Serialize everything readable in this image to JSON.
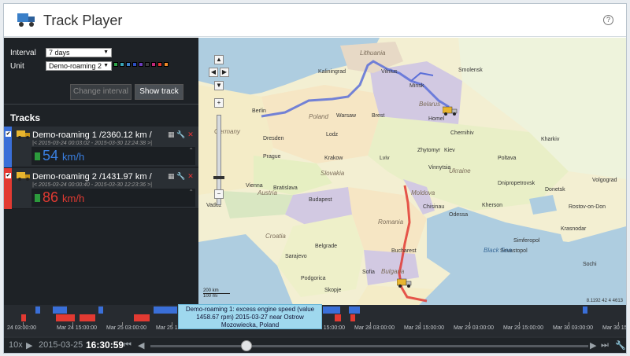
{
  "app": {
    "title": "Track Player",
    "help": "?"
  },
  "controls": {
    "interval_label": "Interval",
    "interval_value": "7 days",
    "unit_label": "Unit",
    "unit_value": "Demo-roaming 2",
    "swatch_colors": [
      "#2ea84a",
      "#3aa6b9",
      "#3d7fc7",
      "#2c4fc2",
      "#6d3dbd",
      "#3c3c3c",
      "#c2287b",
      "#e23a32",
      "#f28c28"
    ],
    "change_interval_label": "Change interval",
    "show_track_label": "Show track"
  },
  "tracks_title": "Tracks",
  "tracks": [
    {
      "name": "Demo-roaming 1 /2360.12 km /",
      "dates": "2015-03-24 00:03:02 - 2015-03-30 12:24:38",
      "speed": "54",
      "speed_unit": "km/h",
      "color": "#3a6fd8"
    },
    {
      "name": "Demo-roaming 2 /1431.97 km /",
      "dates": "2015-03-24 00:00:40 - 2015-03-30 12:23:36",
      "speed": "86",
      "speed_unit": "km/h",
      "color": "#e23a32"
    }
  ],
  "map": {
    "countries": [
      "Lithuania",
      "Belarus",
      "Poland",
      "Germany",
      "Ukraine",
      "Slovakia",
      "Austria",
      "Moldova",
      "Romania",
      "Croatia",
      "Bulgaria"
    ],
    "cities": [
      "Smolensk",
      "Vilnius",
      "Minsk",
      "Kaliningrad",
      "Berlin",
      "Warsaw",
      "Brest",
      "Homel",
      "Chernihiv",
      "Dresden",
      "Lodz",
      "Kiev",
      "Prague",
      "Zhytomyr",
      "Kharkiv",
      "Krakow",
      "Lviv",
      "Poltava",
      "Vinnytsia",
      "Bratislava",
      "Vienna",
      "Budapest",
      "Dnipropetrovsk",
      "Chisinau",
      "Odessa",
      "Belgrade",
      "Sarajevo",
      "Bucharest",
      "Sofia",
      "Simferopol",
      "Sevastopol",
      "Podgorica",
      "Skopje",
      "Vaduz",
      "Kherson",
      "Volgograd",
      "Donetsk",
      "Rostov-on-Don",
      "Krasnodar",
      "Sochi"
    ],
    "sea": "Black Sea",
    "scale_km": "200 km",
    "scale_mi": "100 mi",
    "version": "8.1192 42 4 4613"
  },
  "timeline": {
    "tick_labels": [
      "24 03:00:00",
      "Mar 24 15:00:00",
      "Mar 25 03:00:00",
      "Mar 25 15:00:00",
      "Mar 26 03:00:00",
      "Mar 26 15:00:00",
      "Mar 27 15:00:00",
      "Mar 28 03:00:00",
      "Mar 28 15:00:00",
      "Mar 29 03:00:00",
      "Mar 29 15:00:00",
      "Mar 30 03:00:00",
      "Mar 30 15:00:00"
    ],
    "tooltip": "Demo-roaming 1: excess engine speed (value 1458.67 rpm) 2015-03-27 near Ostrow Mozowiecka, Poland",
    "speed_factor": "10x",
    "date": "2015-03-25",
    "time": "16:30:59",
    "progress": 0.22
  }
}
